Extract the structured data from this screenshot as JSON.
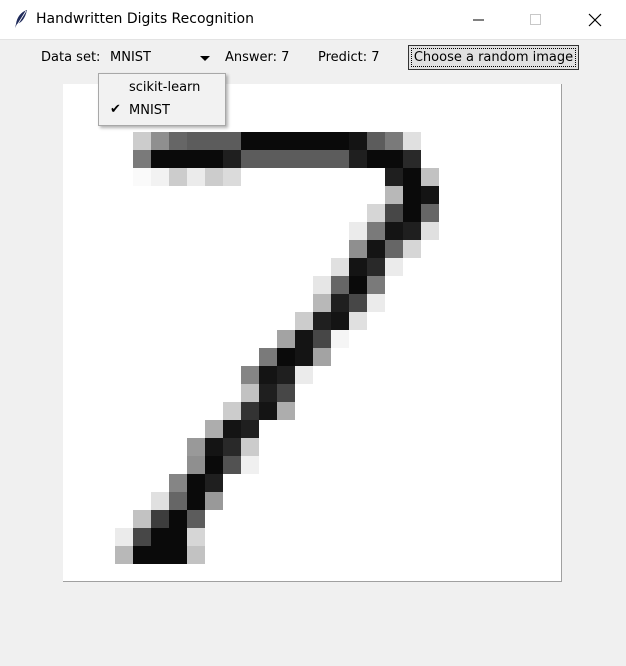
{
  "window": {
    "title": "Handwritten Digits Recognition",
    "controls": [
      "minimize",
      "maximize",
      "close"
    ]
  },
  "toolbar": {
    "dataset_label": "Data set:",
    "dataset_value": "MNIST",
    "answer_text": "Answer: 7",
    "predict_text": "Predict: 7",
    "random_button_label": "Choose a random image"
  },
  "dropdown": {
    "options": [
      {
        "label": "scikit-learn",
        "checked": false
      },
      {
        "label": "MNIST",
        "checked": true
      }
    ],
    "check_glyph": "✔"
  },
  "digit_image": {
    "grid_size": 28,
    "pixels": [
      [
        6,
        23,
        20
      ],
      [
        7,
        23,
        44
      ],
      [
        8,
        23,
        60
      ],
      [
        9,
        23,
        64
      ],
      [
        10,
        23,
        64
      ],
      [
        11,
        23,
        64
      ],
      [
        12,
        23,
        96
      ],
      [
        13,
        23,
        96
      ],
      [
        14,
        23,
        96
      ],
      [
        15,
        23,
        96
      ],
      [
        16,
        23,
        96
      ],
      [
        17,
        23,
        96
      ],
      [
        18,
        23,
        92
      ],
      [
        19,
        23,
        64
      ],
      [
        20,
        23,
        52
      ],
      [
        21,
        23,
        12
      ],
      [
        6,
        22,
        52
      ],
      [
        7,
        22,
        96
      ],
      [
        8,
        22,
        96
      ],
      [
        9,
        22,
        96
      ],
      [
        10,
        22,
        96
      ],
      [
        11,
        22,
        88
      ],
      [
        12,
        22,
        64
      ],
      [
        13,
        22,
        64
      ],
      [
        14,
        22,
        64
      ],
      [
        15,
        22,
        64
      ],
      [
        16,
        22,
        64
      ],
      [
        17,
        22,
        64
      ],
      [
        18,
        22,
        88
      ],
      [
        19,
        22,
        96
      ],
      [
        20,
        22,
        96
      ],
      [
        21,
        22,
        84
      ],
      [
        6,
        21,
        2
      ],
      [
        7,
        21,
        5
      ],
      [
        8,
        21,
        20
      ],
      [
        9,
        21,
        8
      ],
      [
        10,
        21,
        20
      ],
      [
        11,
        21,
        14
      ],
      [
        20,
        21,
        88
      ],
      [
        21,
        21,
        96
      ],
      [
        22,
        21,
        24
      ],
      [
        20,
        20,
        28
      ],
      [
        21,
        20,
        96
      ],
      [
        22,
        20,
        92
      ],
      [
        19,
        19,
        16
      ],
      [
        20,
        19,
        72
      ],
      [
        21,
        19,
        96
      ],
      [
        22,
        19,
        60
      ],
      [
        18,
        18,
        8
      ],
      [
        19,
        18,
        52
      ],
      [
        20,
        18,
        92
      ],
      [
        21,
        18,
        88
      ],
      [
        22,
        18,
        12
      ],
      [
        18,
        17,
        44
      ],
      [
        19,
        17,
        92
      ],
      [
        20,
        17,
        60
      ],
      [
        21,
        17,
        16
      ],
      [
        17,
        16,
        12
      ],
      [
        18,
        16,
        92
      ],
      [
        19,
        16,
        84
      ],
      [
        20,
        16,
        8
      ],
      [
        16,
        15,
        10
      ],
      [
        17,
        15,
        60
      ],
      [
        18,
        15,
        96
      ],
      [
        19,
        15,
        52
      ],
      [
        16,
        14,
        28
      ],
      [
        17,
        14,
        88
      ],
      [
        18,
        14,
        72
      ],
      [
        19,
        14,
        8
      ],
      [
        15,
        13,
        20
      ],
      [
        16,
        13,
        88
      ],
      [
        17,
        13,
        92
      ],
      [
        18,
        13,
        12
      ],
      [
        14,
        12,
        36
      ],
      [
        15,
        12,
        92
      ],
      [
        16,
        12,
        72
      ],
      [
        17,
        12,
        4
      ],
      [
        13,
        11,
        52
      ],
      [
        14,
        11,
        96
      ],
      [
        15,
        11,
        92
      ],
      [
        16,
        11,
        36
      ],
      [
        12,
        10,
        48
      ],
      [
        13,
        10,
        92
      ],
      [
        14,
        10,
        88
      ],
      [
        15,
        10,
        8
      ],
      [
        12,
        9,
        24
      ],
      [
        13,
        9,
        88
      ],
      [
        14,
        9,
        72
      ],
      [
        11,
        8,
        20
      ],
      [
        12,
        8,
        80
      ],
      [
        13,
        8,
        92
      ],
      [
        14,
        8,
        32
      ],
      [
        10,
        7,
        32
      ],
      [
        11,
        7,
        92
      ],
      [
        12,
        7,
        88
      ],
      [
        9,
        6,
        40
      ],
      [
        10,
        6,
        92
      ],
      [
        11,
        6,
        84
      ],
      [
        12,
        6,
        20
      ],
      [
        9,
        5,
        44
      ],
      [
        10,
        5,
        96
      ],
      [
        11,
        5,
        68
      ],
      [
        12,
        5,
        6
      ],
      [
        8,
        4,
        48
      ],
      [
        9,
        4,
        96
      ],
      [
        10,
        4,
        88
      ],
      [
        7,
        3,
        12
      ],
      [
        8,
        3,
        60
      ],
      [
        9,
        3,
        96
      ],
      [
        10,
        3,
        40
      ],
      [
        6,
        2,
        24
      ],
      [
        7,
        2,
        76
      ],
      [
        8,
        2,
        96
      ],
      [
        9,
        2,
        64
      ],
      [
        5,
        1,
        8
      ],
      [
        6,
        1,
        72
      ],
      [
        7,
        1,
        96
      ],
      [
        8,
        1,
        96
      ],
      [
        9,
        1,
        16
      ],
      [
        5,
        0,
        28
      ],
      [
        6,
        0,
        96
      ],
      [
        7,
        0,
        96
      ],
      [
        8,
        0,
        96
      ],
      [
        9,
        0,
        24
      ]
    ]
  }
}
